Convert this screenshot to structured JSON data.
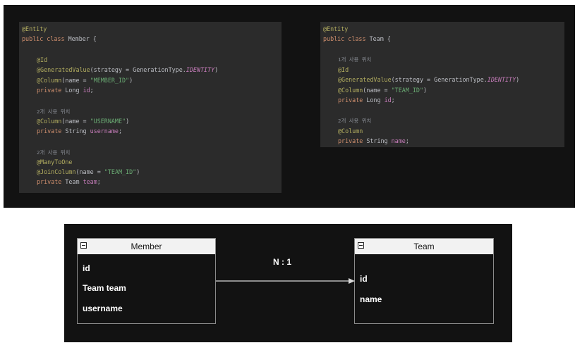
{
  "member_code": {
    "entity_annotation": "@Entity",
    "class_decl_prefix": "public class ",
    "class_name": "Member",
    "class_open": " {",
    "id_annotation": "@Id",
    "generated_annotation": "@GeneratedValue",
    "generated_args_prefix": "(strategy = GenerationType.",
    "generated_constant": "IDENTITY",
    "generated_args_suffix": ")",
    "column1_annotation": "@Column",
    "column1_args_prefix": "(name = ",
    "column1_value": "\"MEMBER_ID\"",
    "column1_args_suffix": ")",
    "field1_modifier": "private ",
    "field1_type": "Long ",
    "field1_name": "id",
    "field1_end": ";",
    "usage1": "2개 사용 위치",
    "column2_annotation": "@Column",
    "column2_args_prefix": "(name = ",
    "column2_value": "\"USERNAME\"",
    "column2_args_suffix": ")",
    "field2_modifier": "private ",
    "field2_type": "String ",
    "field2_name": "username",
    "field2_end": ";",
    "usage2": "2개 사용 위치",
    "manytoone_annotation": "@ManyToOne",
    "joincolumn_annotation": "@JoinColumn",
    "joincolumn_args_prefix": "(name = ",
    "joincolumn_value": "\"TEAM_ID\"",
    "joincolumn_args_suffix": ")",
    "field3_modifier": "private ",
    "field3_type": "Team ",
    "field3_name": "team",
    "field3_end": ";"
  },
  "team_code": {
    "entity_annotation": "@Entity",
    "class_decl_prefix": "public class ",
    "class_name": "Team",
    "class_open": " {",
    "usage1": "1개 사용 위치",
    "id_annotation": "@Id",
    "generated_annotation": "@GeneratedValue",
    "generated_args_prefix": "(strategy = GenerationType.",
    "generated_constant": "IDENTITY",
    "generated_args_suffix": ")",
    "column1_annotation": "@Column",
    "column1_args_prefix": "(name = ",
    "column1_value": "\"TEAM_ID\"",
    "column1_args_suffix": ")",
    "field1_modifier": "private ",
    "field1_type": "Long ",
    "field1_name": "id",
    "field1_end": ";",
    "usage2": "2개 사용 위치",
    "column2_annotation": "@Column",
    "field2_modifier": "private ",
    "field2_type": "String ",
    "field2_name": "name",
    "field2_end": ";"
  },
  "diagram": {
    "member_entity": {
      "title": "Member",
      "fields": [
        "id",
        "Team team",
        "username"
      ]
    },
    "team_entity": {
      "title": "Team",
      "fields": [
        "id",
        "name"
      ]
    },
    "relationship_label": "N : 1"
  },
  "colors": {
    "panel_background": "#121212",
    "code_background": "#2b2b2b",
    "annotation": "#b3ae60",
    "keyword": "#cf8e6d",
    "string": "#6aab73",
    "field": "#c77dbb",
    "entity_header": "#f2f2f2",
    "arrow": "#d9d9d9"
  }
}
